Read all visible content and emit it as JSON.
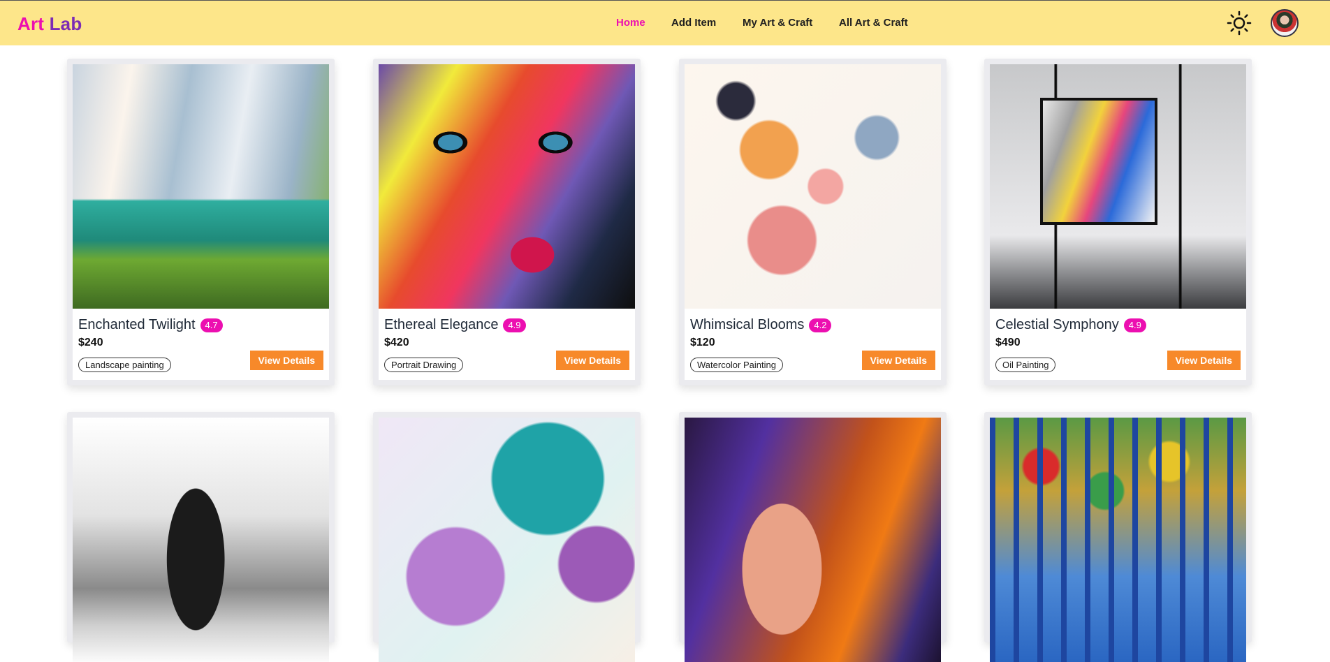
{
  "navbar": {
    "logo_part1": "Art",
    "logo_part2": "Lab",
    "links": [
      {
        "label": "Home",
        "active": true
      },
      {
        "label": "Add Item",
        "active": false
      },
      {
        "label": "My Art & Craft",
        "active": false
      },
      {
        "label": "All Art & Craft",
        "active": false
      }
    ],
    "theme_icon": "sun-icon",
    "avatar": "user-avatar"
  },
  "colors": {
    "navbar_bg": "#fde68a",
    "logo_pink": "#ec0fb0",
    "logo_purple": "#7c2bb5",
    "rating_bg": "#ec0fb0",
    "button_bg": "#f7892a"
  },
  "cards": [
    {
      "title": "Enchanted Twilight",
      "rating": "4.7",
      "price": "$240",
      "category": "Landscape painting",
      "button": "View Details"
    },
    {
      "title": "Ethereal Elegance",
      "rating": "4.9",
      "price": "$420",
      "category": "Portrait Drawing",
      "button": "View Details"
    },
    {
      "title": "Whimsical Blooms",
      "rating": "4.2",
      "price": "$120",
      "category": "Watercolor Painting",
      "button": "View Details"
    },
    {
      "title": "Celestial Symphony",
      "rating": "4.9",
      "price": "$490",
      "category": "Oil Painting",
      "button": "View Details"
    },
    {
      "title": "",
      "rating": "",
      "price": "",
      "category": "",
      "button": ""
    },
    {
      "title": "",
      "rating": "",
      "price": "",
      "category": "",
      "button": ""
    },
    {
      "title": "",
      "rating": "",
      "price": "",
      "category": "",
      "button": ""
    },
    {
      "title": "",
      "rating": "",
      "price": "",
      "category": "",
      "button": ""
    }
  ]
}
